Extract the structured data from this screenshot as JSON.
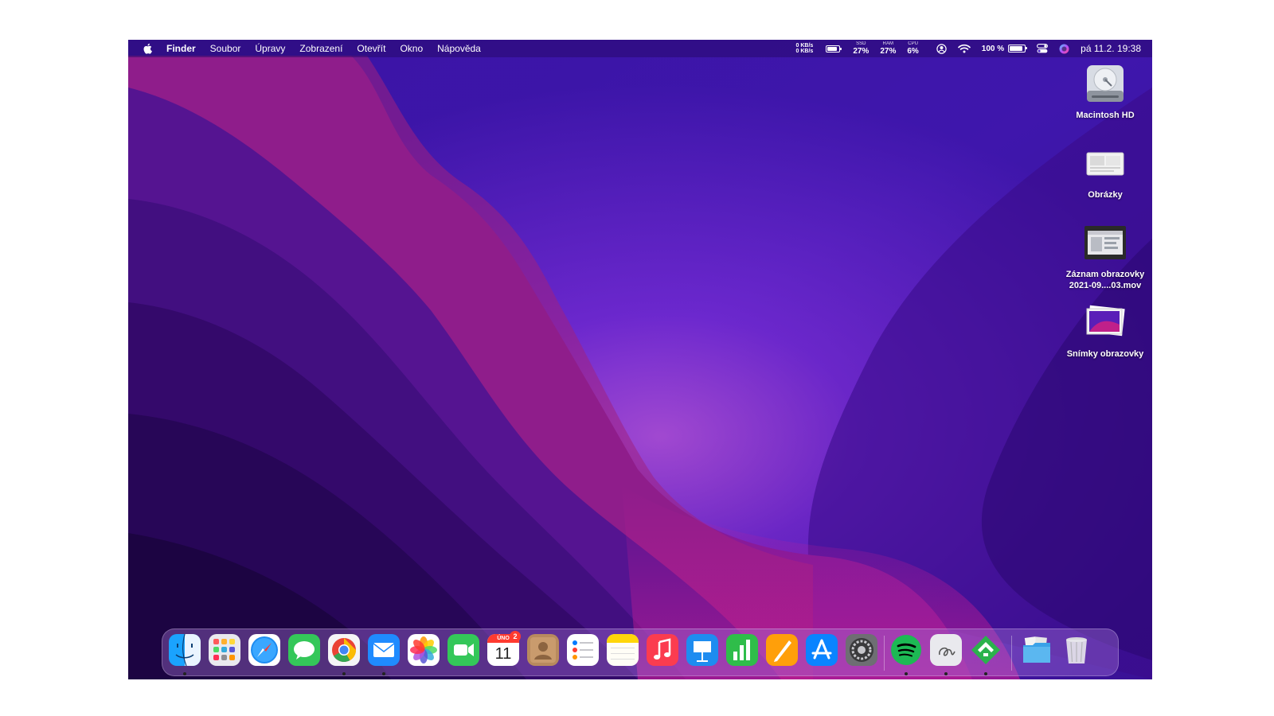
{
  "menubar": {
    "apple_icon": "apple-logo-icon",
    "app_name": "Finder",
    "menus": [
      "Soubor",
      "Úpravy",
      "Zobrazení",
      "Otevřít",
      "Okno",
      "Nápověda"
    ],
    "net_up": "0 KB/s",
    "net_down": "0 KB/s",
    "ssd_label": "SSD",
    "ssd_value": "27%",
    "ram_label": "RAM",
    "ram_value": "27%",
    "cpu_label": "CPU",
    "cpu_value": "6%",
    "battery_percent": "100 %",
    "datetime": "pá 11.2.  19:38"
  },
  "desktop_icons": [
    {
      "label": "Macintosh HD",
      "icon": "hard-drive-icon"
    },
    {
      "label": "Obrázky",
      "icon": "folder-pictures-icon"
    },
    {
      "label": "Záznam obrazovky\n2021-09....03.mov",
      "line1": "Záznam obrazovky",
      "line2": "2021-09....03.mov",
      "icon": "video-file-icon"
    },
    {
      "label": "Snímky obrazovky",
      "icon": "screenshot-icon"
    }
  ],
  "dock": {
    "apps": [
      {
        "name": "Finder",
        "icon": "finder-icon",
        "running": true
      },
      {
        "name": "Launchpad",
        "icon": "launchpad-icon",
        "running": false
      },
      {
        "name": "Safari",
        "icon": "safari-icon",
        "running": false
      },
      {
        "name": "Messages",
        "icon": "messages-icon",
        "running": false
      },
      {
        "name": "Chrome",
        "icon": "chrome-icon",
        "running": true
      },
      {
        "name": "Mail",
        "icon": "mail-icon",
        "running": true
      },
      {
        "name": "Photos",
        "icon": "photos-icon",
        "running": false
      },
      {
        "name": "FaceTime",
        "icon": "facetime-icon",
        "running": false
      },
      {
        "name": "Calendar",
        "icon": "calendar-icon",
        "running": false
      },
      {
        "name": "Contacts",
        "icon": "contacts-icon",
        "running": false
      },
      {
        "name": "Reminders",
        "icon": "reminders-icon",
        "running": false
      },
      {
        "name": "Notes",
        "icon": "notes-icon",
        "running": false
      },
      {
        "name": "Music",
        "icon": "music-icon",
        "running": false
      },
      {
        "name": "Keynote",
        "icon": "keynote-icon",
        "running": false
      },
      {
        "name": "Numbers",
        "icon": "numbers-icon",
        "running": false
      },
      {
        "name": "Pages",
        "icon": "pages-icon",
        "running": false
      },
      {
        "name": "App Store",
        "icon": "app-store-icon",
        "running": false
      },
      {
        "name": "System Preferences",
        "icon": "system-preferences-icon",
        "running": false
      },
      {
        "name": "Spotify",
        "icon": "spotify-icon",
        "running": true
      },
      {
        "name": "Script Editor",
        "icon": "signature-app-icon",
        "running": true
      },
      {
        "name": "Feedly",
        "icon": "feedly-icon",
        "running": true
      },
      {
        "name": "Downloads",
        "icon": "downloads-folder-icon",
        "running": false
      },
      {
        "name": "Trash",
        "icon": "trash-icon",
        "running": false
      }
    ],
    "calendar_month": "ÚNO",
    "calendar_day": "11",
    "calendar_badge": "2"
  },
  "colors": {
    "accent_purple": "#5a1fc0",
    "magenta": "#c0208a"
  }
}
